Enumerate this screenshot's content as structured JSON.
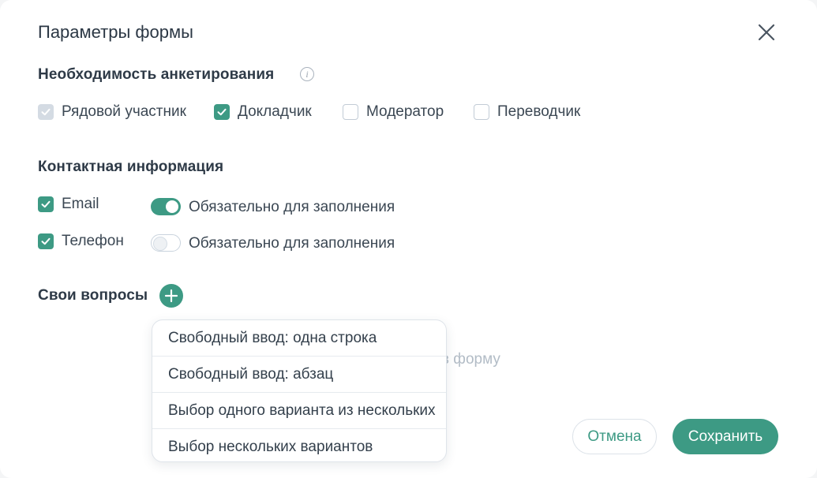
{
  "dialog": {
    "title": "Параметры формы"
  },
  "survey": {
    "title": "Необходимость анкетирования",
    "info_glyph": "i",
    "options": [
      {
        "label": "Рядовой участник",
        "state": "checked-disabled"
      },
      {
        "label": "Докладчик",
        "state": "checked"
      },
      {
        "label": "Модератор",
        "state": "unchecked"
      },
      {
        "label": "Переводчик",
        "state": "unchecked"
      }
    ]
  },
  "contact": {
    "title": "Контактная информация",
    "fields": [
      {
        "label": "Email",
        "checked": true,
        "required_label": "Обязательно для заполнения",
        "required": true
      },
      {
        "label": "Телефон",
        "checked": true,
        "required_label": "Обязательно для заполнения",
        "required": false
      }
    ]
  },
  "custom": {
    "title": "Свои вопросы",
    "hint_visible": "ы в форму",
    "menu": [
      "Свободный ввод: одна строка",
      "Свободный ввод: абзац",
      "Выбор одного варианта из нескольких",
      "Выбор нескольких вариантов"
    ]
  },
  "footer": {
    "cancel": "Отмена",
    "save": "Сохранить"
  },
  "colors": {
    "accent": "#3d9a84",
    "text": "#2e3a47",
    "muted": "#b2bcc6",
    "disabled_check": "#d4dbe3"
  }
}
